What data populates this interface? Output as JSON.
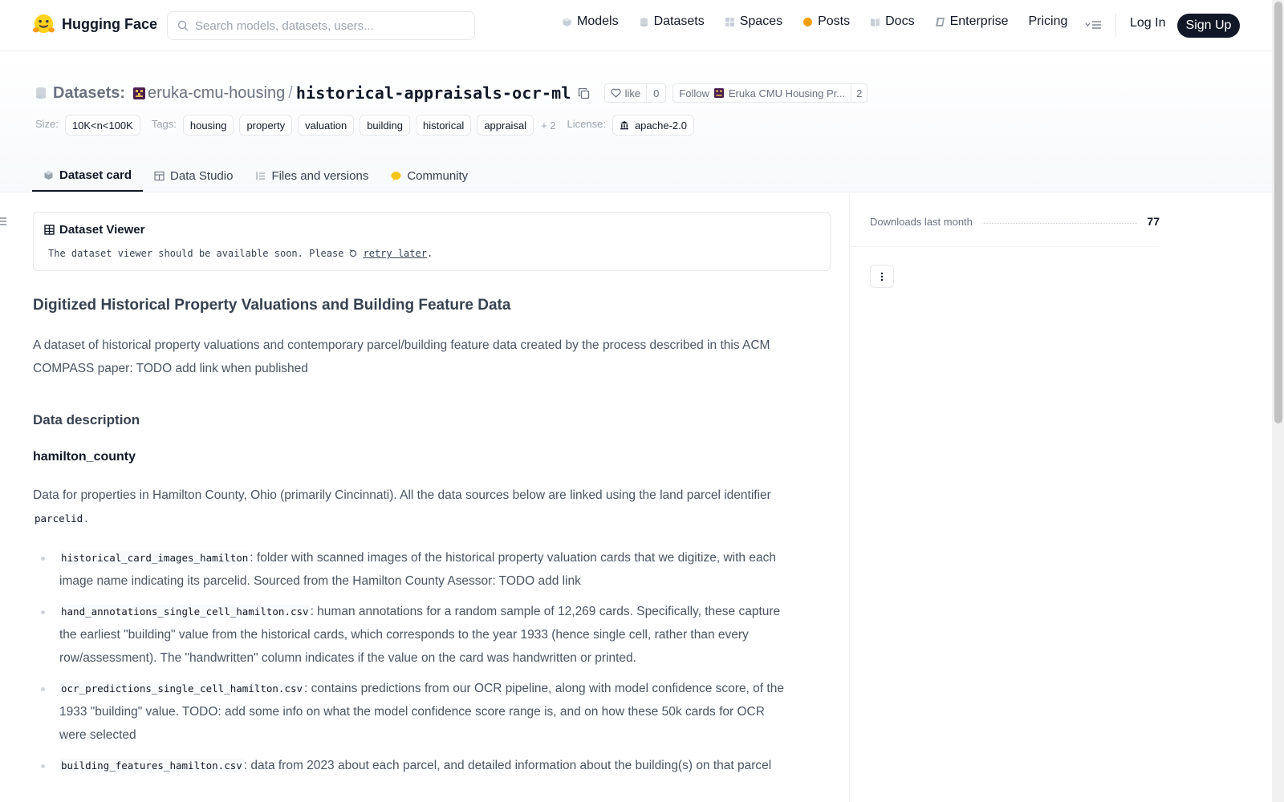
{
  "nav": {
    "brand": "Hugging Face",
    "search_placeholder": "Search models, datasets, users...",
    "links": [
      "Models",
      "Datasets",
      "Spaces",
      "Posts",
      "Docs",
      "Enterprise",
      "Pricing"
    ],
    "login": "Log In",
    "signup": "Sign Up"
  },
  "header": {
    "section_label": "Datasets:",
    "org": "eruka-cmu-housing",
    "separator": "/",
    "repo": "historical-appraisals-ocr-ml",
    "like_label": "like",
    "like_count": "0",
    "follow_label": "Follow",
    "follow_org": "Eruka CMU Housing Pr...",
    "follow_count": "2",
    "size_label": "Size:",
    "size_value": "10K<n<100K",
    "tags_label": "Tags:",
    "tags": [
      "housing",
      "property",
      "valuation",
      "building",
      "historical",
      "appraisal"
    ],
    "more_tags": "+ 2",
    "license_label": "License:",
    "license_value": "apache-2.0"
  },
  "tabs": [
    "Dataset card",
    "Data Studio",
    "Files and versions",
    "Community"
  ],
  "viewer": {
    "title": "Dataset Viewer",
    "message_prefix": "The dataset viewer should be available soon. Please",
    "retry": "retry later",
    "message_suffix": "."
  },
  "card": {
    "title": "Digitized Historical Property Valuations and Building Feature Data",
    "intro": "A dataset of historical property valuations and contemporary parcel/building feature data created by the process described in this ACM COMPASS paper: TODO add link when published",
    "section": "Data description",
    "subsection": "hamilton_county",
    "para_prefix": "Data for properties in Hamilton County, Ohio (primarily Cincinnati). All the data sources below are linked using the land parcel identifier",
    "para_code": "parcelid",
    "para_suffix": ".",
    "items": [
      {
        "code": "historical_card_images_hamilton",
        "text": ": folder with scanned images of the historical property valuation cards that we digitize, with each image name indicating its parcelid. Sourced from the Hamilton County Asessor: TODO add link"
      },
      {
        "code": "hand_annotations_single_cell_hamilton.csv",
        "text": ": human annotations for a random sample of 12,269 cards. Specifically, these capture the earliest \"building\" value from the historical cards, which corresponds to the year 1933 (hence single cell, rather than every row/assessment). The \"handwritten\" column indicates if the value on the card was handwritten or printed."
      },
      {
        "code": "ocr_predictions_single_cell_hamilton.csv",
        "text": ": contains predictions from our OCR pipeline, along with model confidence score, of the 1933 \"building\" value. TODO: add some info on what the model confidence score range is, and on how these 50k cards for OCR were selected"
      },
      {
        "code": "building_features_hamilton.csv",
        "text": ": data from 2023 about each parcel, and detailed information about the building(s) on that parcel"
      }
    ]
  },
  "sidebar": {
    "downloads_label": "Downloads last month",
    "downloads_value": "77"
  }
}
